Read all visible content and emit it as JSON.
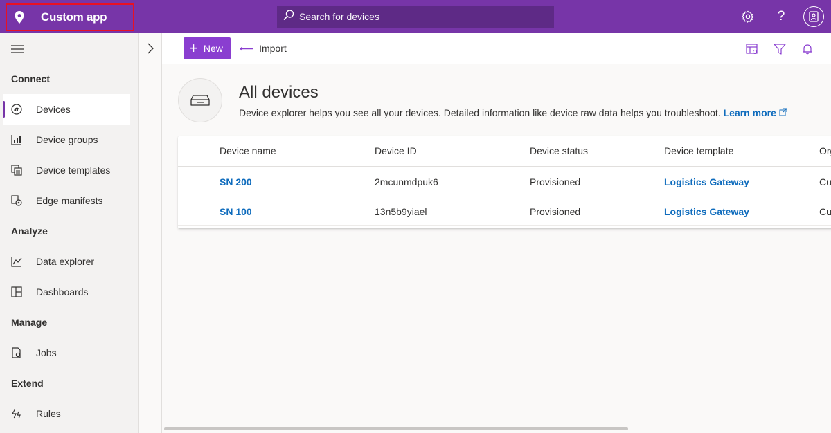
{
  "topbar": {
    "app_name": "Custom app",
    "search_placeholder": "Search for devices",
    "icons": [
      "settings-icon",
      "help-icon",
      "avatar-icon"
    ]
  },
  "sidebar": {
    "sections": [
      {
        "title": "Connect",
        "items": [
          {
            "label": "Devices",
            "icon": "devices-icon",
            "active": true
          },
          {
            "label": "Device groups",
            "icon": "device-groups-icon"
          },
          {
            "label": "Device templates",
            "icon": "device-templates-icon"
          },
          {
            "label": "Edge manifests",
            "icon": "edge-manifests-icon"
          }
        ]
      },
      {
        "title": "Analyze",
        "items": [
          {
            "label": "Data explorer",
            "icon": "data-explorer-icon"
          },
          {
            "label": "Dashboards",
            "icon": "dashboards-icon"
          }
        ]
      },
      {
        "title": "Manage",
        "items": [
          {
            "label": "Jobs",
            "icon": "jobs-icon"
          }
        ]
      },
      {
        "title": "Extend",
        "items": [
          {
            "label": "Rules",
            "icon": "rules-icon"
          }
        ]
      }
    ]
  },
  "toolbar": {
    "new_label": "New",
    "import_label": "Import",
    "right_icons": [
      "edit-columns-icon",
      "filter-icon",
      "notifications-icon"
    ]
  },
  "main": {
    "title": "All devices",
    "description": "Device explorer helps you see all your devices. Detailed information like device raw data helps you troubleshoot.",
    "learn_more": "Learn more",
    "table": {
      "columns": [
        "Device name",
        "Device ID",
        "Device status",
        "Device template",
        "Org"
      ],
      "rows": [
        {
          "name": "SN 200",
          "id": "2mcunmdpuk6",
          "status": "Provisioned",
          "template": "Logistics Gateway",
          "org": "Cu"
        },
        {
          "name": "SN 100",
          "id": "13n5b9yiael",
          "status": "Provisioned",
          "template": "Logistics Gateway",
          "org": "Cu"
        }
      ]
    }
  },
  "colors": {
    "brand": "#7735a8",
    "primary_button": "#8a3ed0",
    "link": "#0f6cbd",
    "highlight_border": "#e81123"
  }
}
